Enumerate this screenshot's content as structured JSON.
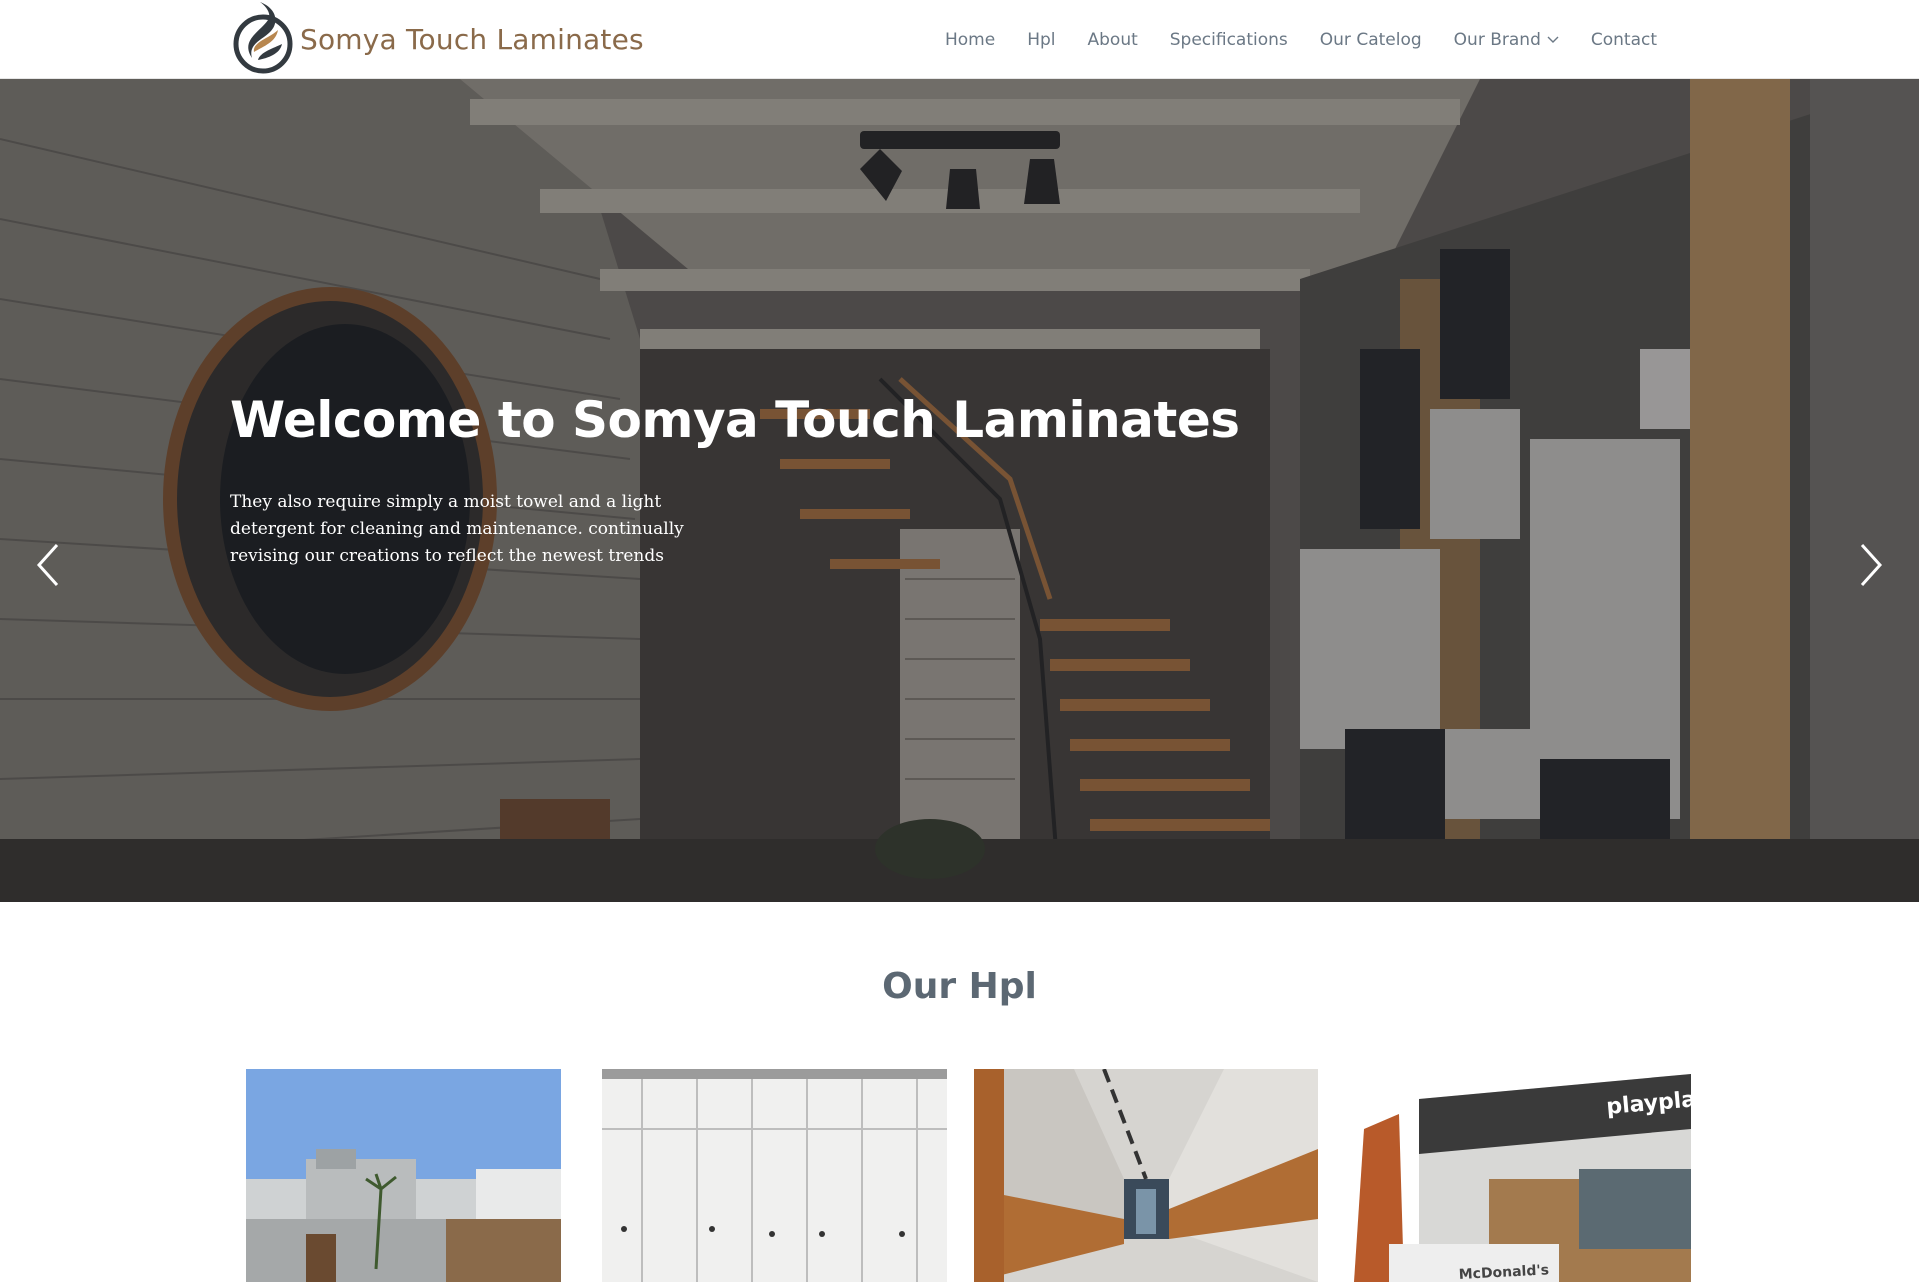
{
  "header": {
    "brand_name": "Somya Touch Laminates",
    "nav": [
      {
        "label": "Home"
      },
      {
        "label": "Hpl"
      },
      {
        "label": "About"
      },
      {
        "label": "Specifications"
      },
      {
        "label": "Our Catelog"
      },
      {
        "label": "Our Brand",
        "dropdown": true
      },
      {
        "label": "Contact"
      }
    ]
  },
  "hero": {
    "title": "Welcome to Somya Touch Laminates",
    "text": "They also require simply a moist towel and a light detergent for cleaning and maintenance. continually revising our creations to reflect the newest trends"
  },
  "section": {
    "title": "Our Hpl"
  },
  "cards": {
    "playplace_sign": "playplace",
    "mcdonalds_sign": "McDonald's"
  },
  "colors": {
    "brand": "#8a6a4a",
    "nav_text": "#6b7885",
    "section_title": "#5c6873"
  }
}
